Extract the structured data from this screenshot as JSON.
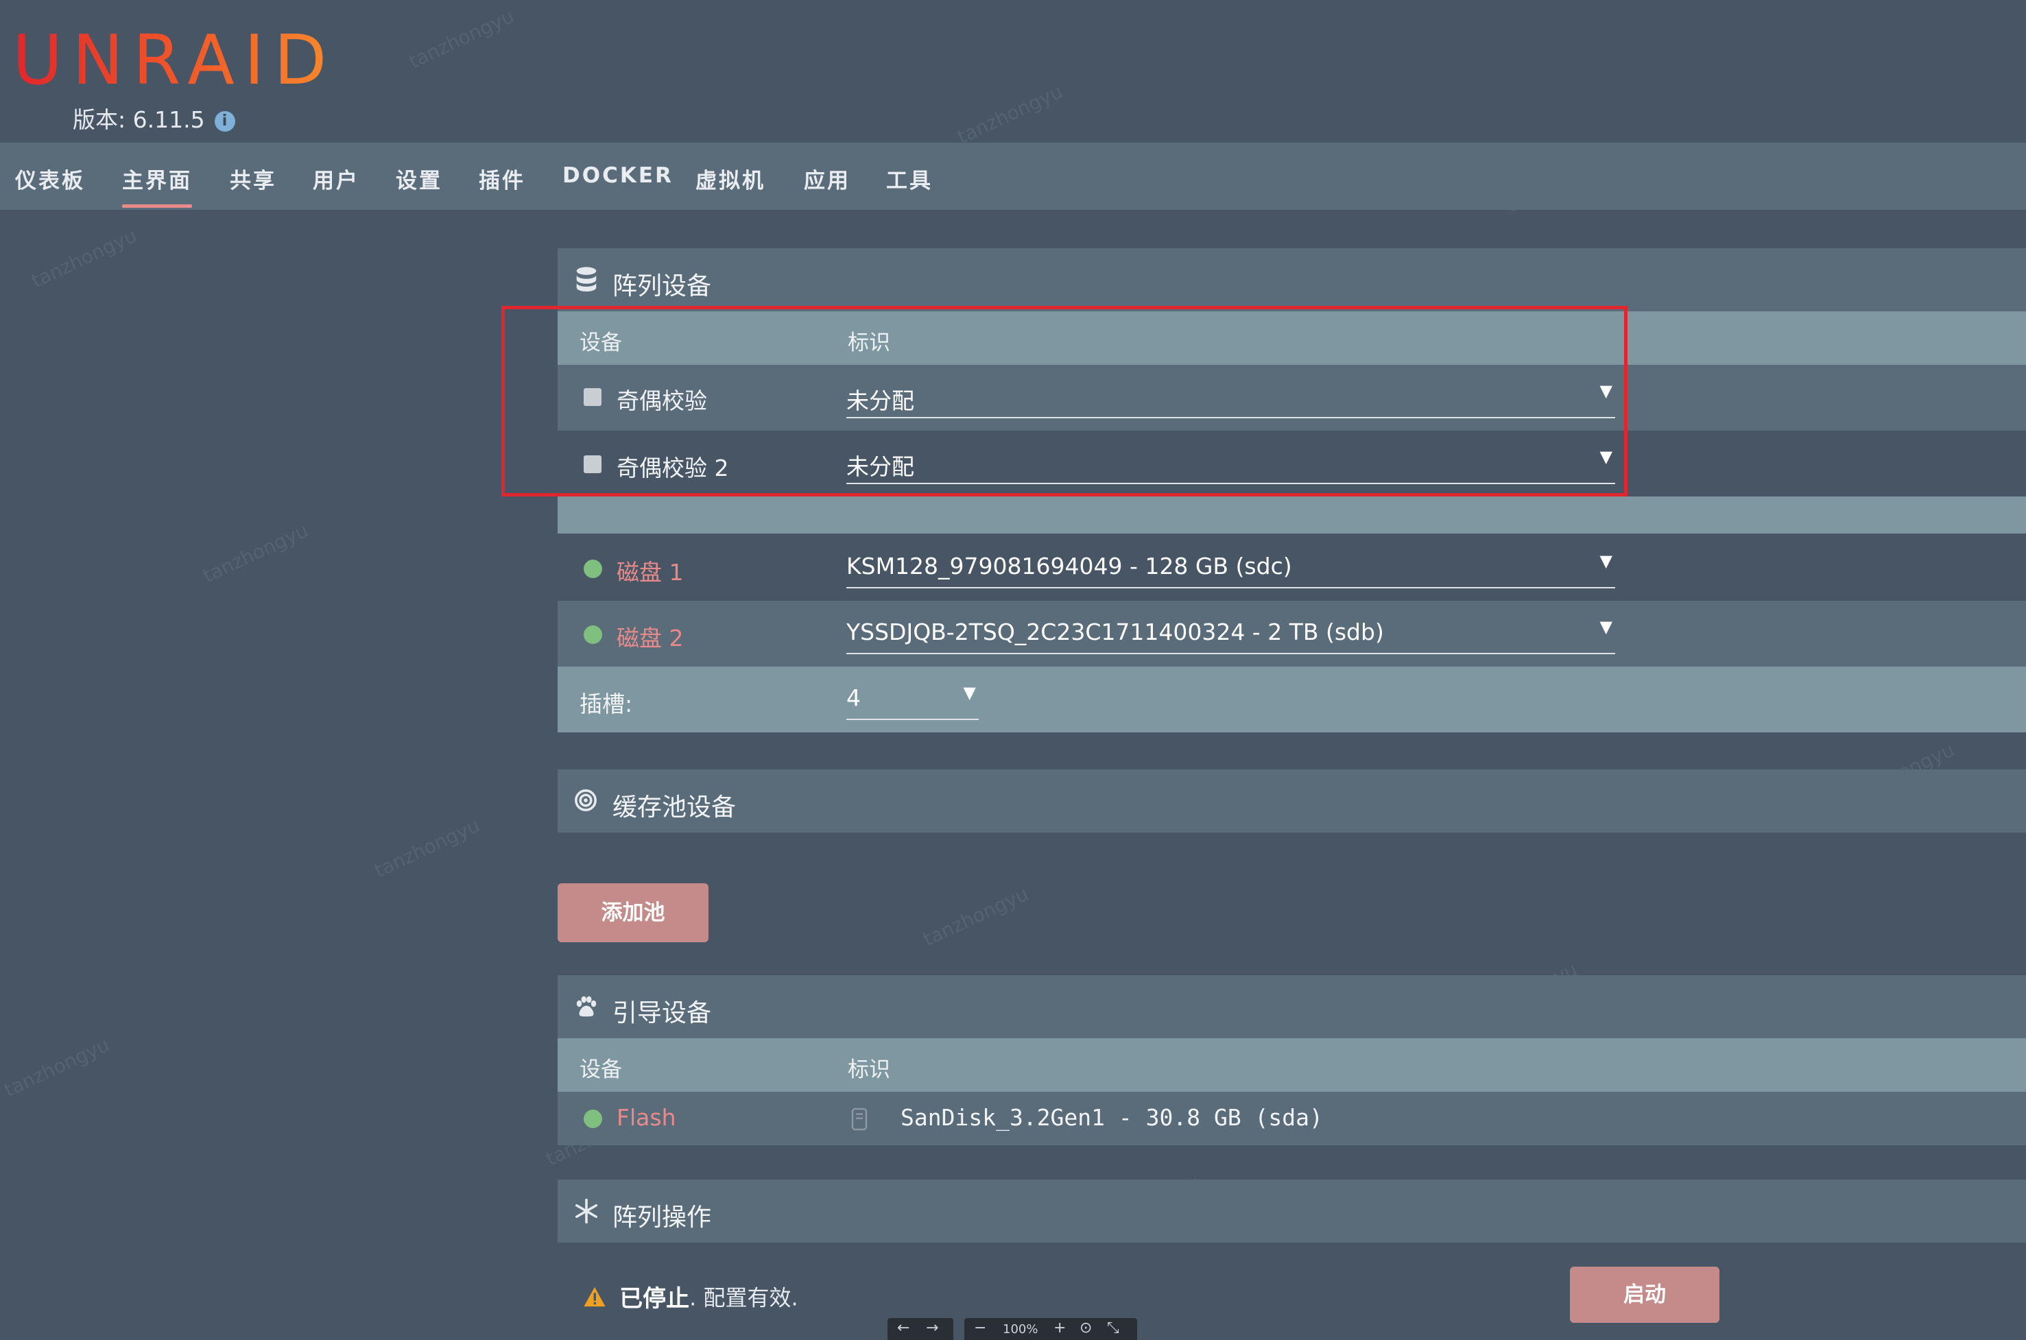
{
  "header": {
    "logo_text": "UNRAID",
    "version_text": "版本: 6.11.5",
    "info_icon": "i"
  },
  "nav": {
    "items": [
      {
        "label": "仪表板"
      },
      {
        "label": "主界面",
        "active": true
      },
      {
        "label": "共享"
      },
      {
        "label": "用户"
      },
      {
        "label": "设置"
      },
      {
        "label": "插件"
      },
      {
        "label": "DOCKER"
      },
      {
        "label": "虚拟机"
      },
      {
        "label": "应用"
      },
      {
        "label": "工具"
      }
    ]
  },
  "array": {
    "title": "阵列设备",
    "col_device": "设备",
    "col_id": "标识",
    "parity1": {
      "label": "奇偶校验",
      "value": "未分配"
    },
    "parity2": {
      "label": "奇偶校验 2",
      "value": "未分配"
    },
    "disk1": {
      "label": "磁盘 1",
      "value": "KSM128_979081694049 - 128 GB (sdc)"
    },
    "disk2": {
      "label": "磁盘 2",
      "value": "YSSDJQB-2TSQ_2C23C1711400324 - 2 TB (sdb)"
    },
    "slots_label": "插槽:",
    "slots_value": "4"
  },
  "cache": {
    "title": "缓存池设备",
    "add_pool_label": "添加池"
  },
  "boot": {
    "title": "引导设备",
    "col_device": "设备",
    "col_id": "标识",
    "flash_label": "Flash",
    "flash_value": "SanDisk_3.2Gen1 - 30.8 GB (sda)"
  },
  "operation": {
    "title": "阵列操作",
    "status_bold": "已停止",
    "status_rest": ". 配置有效.",
    "start_label": "启动"
  },
  "zoom": {
    "level": "100%"
  },
  "watermark": "tanzhongyu",
  "colors": {
    "accent_red": "#e98a8a",
    "button": "#c58a8a",
    "status_green": "#7fbf7f",
    "highlight_box": "#e0262e"
  }
}
